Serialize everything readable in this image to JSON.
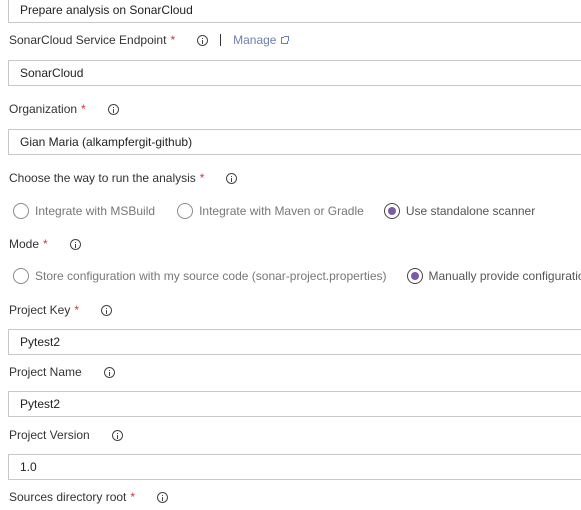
{
  "task_title_field": {
    "value": "Prepare analysis on SonarCloud"
  },
  "endpoint": {
    "label": "SonarCloud Service Endpoint",
    "required": "*",
    "manage_label": "Manage",
    "value": "SonarCloud"
  },
  "organization": {
    "label": "Organization",
    "required": "*",
    "value": "Gian Maria  (alkampfergit-github)"
  },
  "run_mode": {
    "label": "Choose the way to run the analysis",
    "required": "*",
    "options": [
      {
        "label": "Integrate with MSBuild",
        "selected": false
      },
      {
        "label": "Integrate with Maven or Gradle",
        "selected": false
      },
      {
        "label": "Use standalone scanner",
        "selected": true
      }
    ]
  },
  "mode": {
    "label": "Mode",
    "required": "*",
    "options": [
      {
        "label": "Store configuration with my source code (sonar-project.properties)",
        "selected": false
      },
      {
        "label": "Manually provide configuration",
        "selected": true
      }
    ]
  },
  "project_key": {
    "label": "Project Key",
    "required": "*",
    "value": "Pytest2"
  },
  "project_name": {
    "label": "Project Name",
    "value": "Pytest2"
  },
  "project_version": {
    "label": "Project Version",
    "value": "1.0"
  },
  "sources_root": {
    "label": "Sources directory root",
    "required": "*"
  },
  "colors": {
    "accent_radio": "#7a5ba6",
    "required_marker": "#d13438",
    "link": "#6d7fb0",
    "input_border": "#c8c8c8"
  },
  "icons": {
    "info": "info-circle-icon",
    "external_link": "external-link-icon"
  }
}
